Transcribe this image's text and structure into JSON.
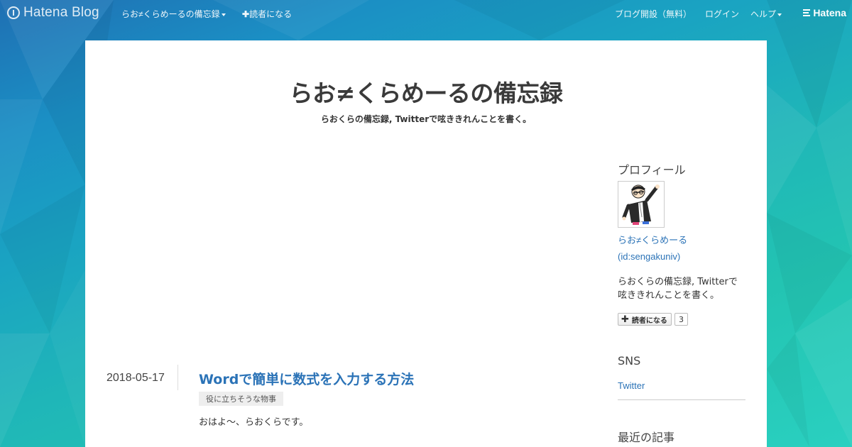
{
  "topbar": {
    "logo_text": "Hatena Blog",
    "blog_menu": "らお≠くらめーるの備忘録",
    "subscribe": "読者になる",
    "start_blog": "ブログ開設（無料）",
    "login": "ログイン",
    "help": "ヘルプ",
    "brand": "Hatena"
  },
  "header": {
    "title": "らお≠くらめーるの備忘録",
    "description": "らおくらの備忘録, Twitterで呟ききれんことを書く。"
  },
  "entry": {
    "date": "2018-05-17",
    "title": "Wordで簡単に数式を入力する方法",
    "category": "役に立ちそうな物事",
    "intro": "おはよ～、らおくらです。"
  },
  "sidebar": {
    "profile_heading": "プロフィール",
    "name": "らお≠くらめーる",
    "id": "(id:sengakuniv)",
    "bio": "らおくらの備忘録, Twitterで呟ききれんことを書く。",
    "subscribe_label": "読者になる",
    "subscriber_count": "3",
    "sns_heading": "SNS",
    "twitter_link": "Twitter",
    "recent_heading": "最近の記事"
  },
  "colors": {
    "accent_link": "#2b73b7",
    "bg_top": "#1f6fb3",
    "bg_bottom": "#2ad0c0"
  }
}
